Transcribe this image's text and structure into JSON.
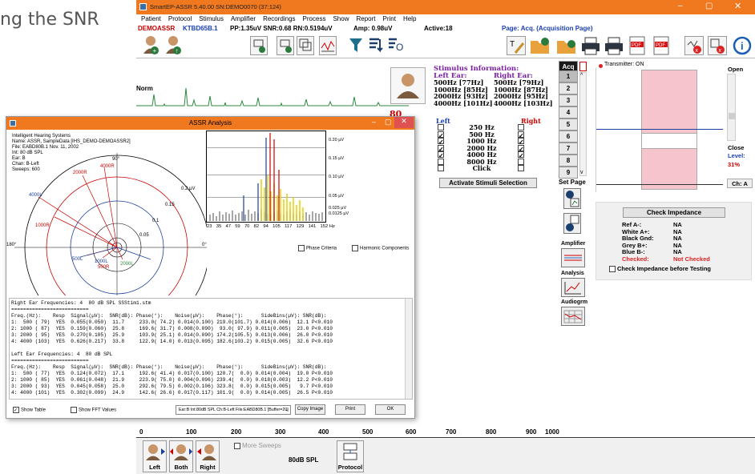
{
  "bg_text": "ng the SNR",
  "app": {
    "title": "SmartEP-ASSR 5.40.00  SN:DEMO0070 (37:124)",
    "menu": [
      "Patient",
      "Protocol",
      "Stimulus",
      "Amplifier",
      "Recordings",
      "Process",
      "Show",
      "Report",
      "Print",
      "Help"
    ],
    "status": {
      "patient": "DEMOASSR",
      "id": "KTBD65B.1",
      "pp": "PP:1.35uV SNR:0.68 RN:0.5194uV",
      "amp": "Amp: 0.98uV",
      "active": "Active:18",
      "page": "Page: Acq. (Acquisition Page)"
    }
  },
  "main_plot": {
    "label": "Norm"
  },
  "stim_info": {
    "title": "Stimulus Information:",
    "left_head": "Left Ear:",
    "right_head": "Right Ear:",
    "left": [
      "500Hz [77Hz]",
      "1000Hz [85Hz]",
      "2000Hz [93Hz]",
      "4000Hz [101Hz]"
    ],
    "right": [
      "500Hz [79Hz]",
      "1000Hz [87Hz]",
      "2000Hz [95Hz]",
      "4000Hz [103Hz]"
    ]
  },
  "stim_sel": {
    "value80": "80",
    "left": "Left",
    "right": "Right",
    "freqs": [
      "250 Hz",
      "500 Hz",
      "1000 Hz",
      "2000 Hz",
      "4000 Hz",
      "8000 Hz",
      "Click"
    ],
    "button": "Activate Stimuli Selection"
  },
  "acq": {
    "label": "Acq",
    "nums": [
      "1",
      "2",
      "3",
      "4",
      "5",
      "6",
      "7",
      "8",
      "9"
    ],
    "set_page": "Set Page",
    "amplifier": "Amplifier",
    "analysis": "Analysis",
    "audiogram": "Audiogrm"
  },
  "transmitter": "Transmitter: ON",
  "side": {
    "open": "Open",
    "close": "Close",
    "level": "Level:",
    "level_val": "31%",
    "ch": "Ch: A"
  },
  "impedance": {
    "button": "Check Impedance",
    "rows": [
      [
        "Ref A-:",
        "NA"
      ],
      [
        "White A+:",
        "NA"
      ],
      [
        "Black Gnd:",
        "NA"
      ],
      [
        "Grey B+:",
        "NA"
      ],
      [
        "Blue B-:",
        "NA"
      ],
      [
        "Checked:",
        "Not Checked"
      ]
    ],
    "check_label": "Check Impedance before Testing"
  },
  "scale": {
    "ticks": [
      "0",
      "100",
      "200",
      "300",
      "400",
      "500",
      "600",
      "700",
      "800",
      "900",
      "1000"
    ],
    "more_sweeps": "More Sweeps",
    "spl": "80dB SPL",
    "buttons": [
      "Left",
      "Both",
      "Right"
    ],
    "protocol": "Protocol"
  },
  "dialog": {
    "title": "ASSR Analysis",
    "info": [
      "Intelligent Hearing Systems",
      "Name: ASSR, SampleData [IHS_DEMO-DEMOASSR2]",
      "File: EABD80B.1  Nov. 11, 2002",
      "Int: 80 dB SPL",
      "Ear: B",
      "Chan: B-Left",
      "Sweeps: 600"
    ],
    "polar": {
      "top": "90°",
      "left": "180°",
      "right": "0°",
      "rings": [
        "0.2 µV",
        "0.15",
        "0.1",
        "0.05"
      ],
      "points": [
        "4000R",
        "2000R",
        "4000L",
        "1000R",
        "1000L",
        "500L",
        "500R",
        "2000L"
      ]
    },
    "spec": {
      "yticks": [
        "0.20 µV",
        "0.15 µV",
        "0.10 µV",
        "0.05 µV",
        "0.025 µV",
        "0.0125 µV"
      ],
      "xticks": [
        "23",
        "35",
        "47",
        "59",
        "70",
        "82",
        "94",
        "105",
        "117",
        "129",
        "141",
        "152 Hz"
      ]
    },
    "phase_criteria": "Phase Criteria",
    "harmonic": "Harmonic Components",
    "table_text": "Right Ear Frequencies: 4  80 dB SPL SSStim1.stm\n==========================\nFreq.(Hz):    Resp  Signal(µV):  SNR(dB): Phase(°):    Noise(µV):    Phase(°):      SideBins(µV): SNR(dB):\n1:  500 ( 79)  YES  0.055(0.050)  11.7     233.0( 74.2) 0.014(0.100) 219.0(101.7) 0.014(0.006)  12.1 P<0.010\n2: 1000 ( 87)  YES  0.159(0.060)  25.8     169.6( 31.7) 0.008(0.090)  93.0( 97.9) 0.011(0.005)  23.0 P<0.010\n3: 2000 ( 95)  YES  0.270(0.105)  25.9     103.9( 25.1) 0.014(0.090) 174.2(105.5) 0.013(0.006)  26.0 P<0.010\n4: 4000 (103)  YES  0.626(0.217)  33.8     122.9( 14.0) 0.013(0.095) 182.6(103.2) 0.015(0.005)  32.6 P<0.010\n\nLeft Ear Frequencies: 4  80 dB SPL\n==========================\nFreq.(Hz):    Resp  Signal(µV):  SNR(dB): Phase(°):    Noise(µV):    Phase(°):      SideBins(µV): SNR(dB):\n1:  500 ( 77)  YES  0.124(0.072)  17.1     192.6( 41.4) 0.017(0.100) 120.7(  0.0) 0.014(0.004)  19.0 P<0.010\n2: 1000 ( 85)  YES  0.061(0.048)  21.9     223.9( 75.0) 0.004(0.096) 239.4(  0.0) 0.018(0.003)  12.2 P<0.010\n3: 2000 ( 93)  YES  0.045(0.058)  25.0     292.6( 79.5) 0.002(0.106) 323.8(  0.0) 0.015(0.005)   9.7 P<0.010\n4: 4000 (101)  YES  0.302(0.099)  24.9     142.6( 26.6) 0.017(0.117) 101.9(  0.0) 0.014(0.005)  26.5 P<0.010",
    "show_table": "Show Table",
    "show_fft": "Show FFT Values",
    "select_value": "Ear:B Int:80dB SPL Ch:B-Left  File:EABD80B.1  [Buffer=20]",
    "copy": "Copy Image",
    "print": "Print",
    "ok": "OK"
  }
}
